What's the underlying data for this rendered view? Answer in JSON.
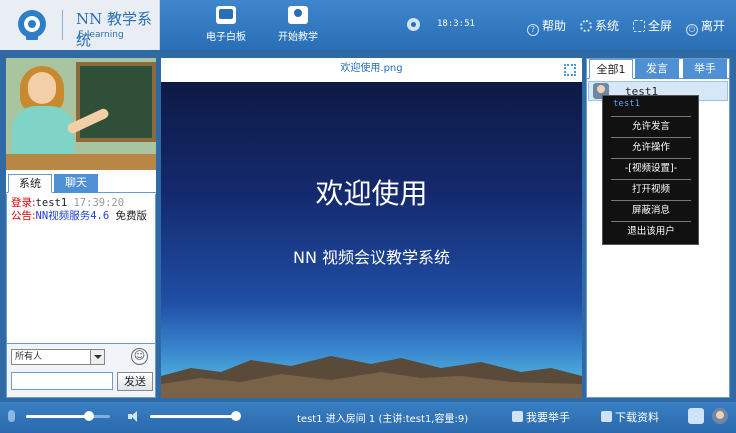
{
  "app": {
    "title": "NN 教学系统",
    "subtitle": "E-learning"
  },
  "topnav": [
    {
      "label": "电子白板",
      "icon": "whiteboard-icon"
    },
    {
      "label": "开始教学",
      "icon": "start-teaching-icon"
    }
  ],
  "clock": "18:3:51",
  "topright": [
    {
      "label": "帮助",
      "icon": "help-icon"
    },
    {
      "label": "系统",
      "icon": "gear-icon"
    },
    {
      "label": "全屏",
      "icon": "fullscreen-icon"
    },
    {
      "label": "离开",
      "icon": "power-icon"
    }
  ],
  "left": {
    "tabs": [
      "系统",
      "聊天"
    ],
    "log": [
      {
        "label": "登录:",
        "user": "test1",
        "time": "17:39:20"
      },
      {
        "label": "公告:",
        "text": "NN视频服务4.6",
        "tail": "免费版"
      }
    ],
    "select_value": "所有人",
    "message_value": "",
    "send_label": "发送"
  },
  "center": {
    "file_name": "欢迎使用.png",
    "slide_title": "欢迎使用",
    "slide_subtitle": "NN 视频会议教学系统"
  },
  "right": {
    "tabs": [
      "全部1",
      "发言",
      "举手"
    ],
    "user": "test1",
    "context_menu": {
      "header": "test1",
      "items": [
        "允许发言",
        "允许操作",
        "-[视频设置]-",
        "打开视频",
        "屏蔽消息",
        "退出该用户"
      ]
    }
  },
  "bottom": {
    "mic_volume": 0.75,
    "speaker_volume": 1.0,
    "status": "test1 进入房间 1 (主讲:test1,容量:9)",
    "raise_hand": "我要举手",
    "download": "下载资料"
  },
  "colors": {
    "primary": "#2a6fb6",
    "tab_blue": "#4f8fd3",
    "red": "#e00000",
    "link_blue": "#1f3fd0"
  }
}
